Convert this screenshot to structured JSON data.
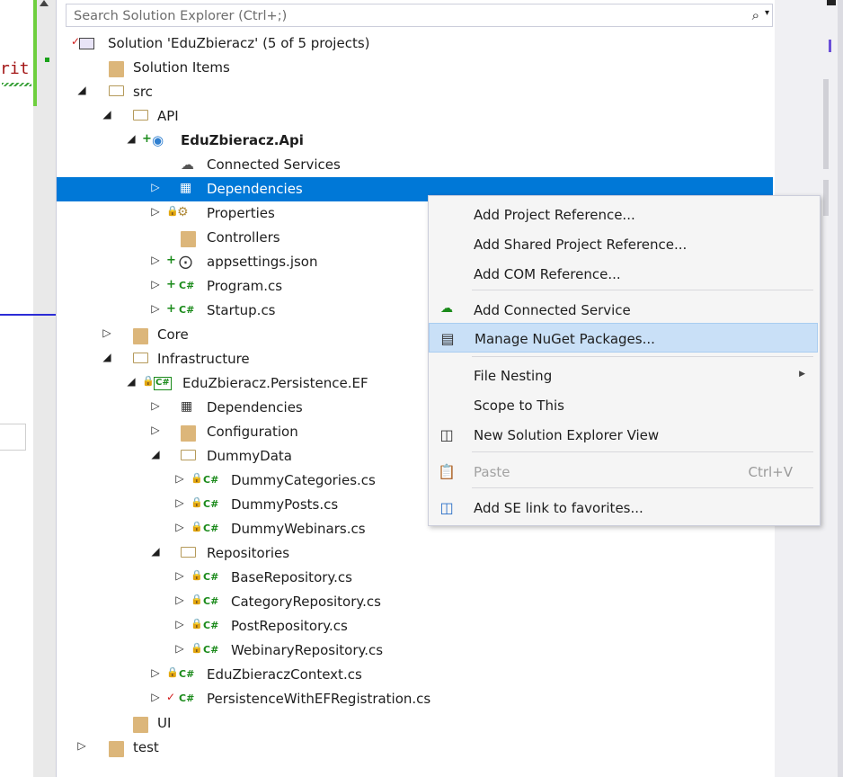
{
  "editor": {
    "code_fragment": "rit"
  },
  "search": {
    "placeholder": "Search Solution Explorer (Ctrl+;)"
  },
  "tree": {
    "rows": [
      {
        "label": "Solution 'EduZbieracz' (5 of 5 projects)"
      },
      {
        "label": "Solution Items"
      },
      {
        "label": "src"
      },
      {
        "label": "API"
      },
      {
        "label": "EduZbieracz.Api"
      },
      {
        "label": "Connected Services"
      },
      {
        "label": "Dependencies"
      },
      {
        "label": "Properties"
      },
      {
        "label": "Controllers"
      },
      {
        "label": "appsettings.json"
      },
      {
        "label": "Program.cs"
      },
      {
        "label": "Startup.cs"
      },
      {
        "label": "Core"
      },
      {
        "label": "Infrastructure"
      },
      {
        "label": "EduZbieracz.Persistence.EF"
      },
      {
        "label": "Dependencies"
      },
      {
        "label": "Configuration"
      },
      {
        "label": "DummyData"
      },
      {
        "label": "DummyCategories.cs"
      },
      {
        "label": "DummyPosts.cs"
      },
      {
        "label": "DummyWebinars.cs"
      },
      {
        "label": "Repositories"
      },
      {
        "label": "BaseRepository.cs"
      },
      {
        "label": "CategoryRepository.cs"
      },
      {
        "label": "PostRepository.cs"
      },
      {
        "label": "WebinaryRepository.cs"
      },
      {
        "label": "EduZbieraczContext.cs"
      },
      {
        "label": "PersistenceWithEFRegistration.cs"
      },
      {
        "label": "UI"
      },
      {
        "label": "test"
      }
    ]
  },
  "context_menu": {
    "items": [
      {
        "label": "Add Project Reference..."
      },
      {
        "label": "Add Shared Project Reference..."
      },
      {
        "label": "Add COM Reference..."
      },
      {
        "label": "Add Connected Service"
      },
      {
        "label": "Manage NuGet Packages..."
      },
      {
        "label": "File Nesting"
      },
      {
        "label": "Scope to This"
      },
      {
        "label": "New Solution Explorer View"
      },
      {
        "label": "Paste",
        "shortcut": "Ctrl+V"
      },
      {
        "label": "Add SE link to favorites..."
      }
    ]
  },
  "icons": {
    "search": "search-icon",
    "csharp_badge": "C#"
  },
  "colors": {
    "selection": "#0078d7",
    "menu_hover": "#c9e0f7",
    "folder": "#dcb67a"
  }
}
